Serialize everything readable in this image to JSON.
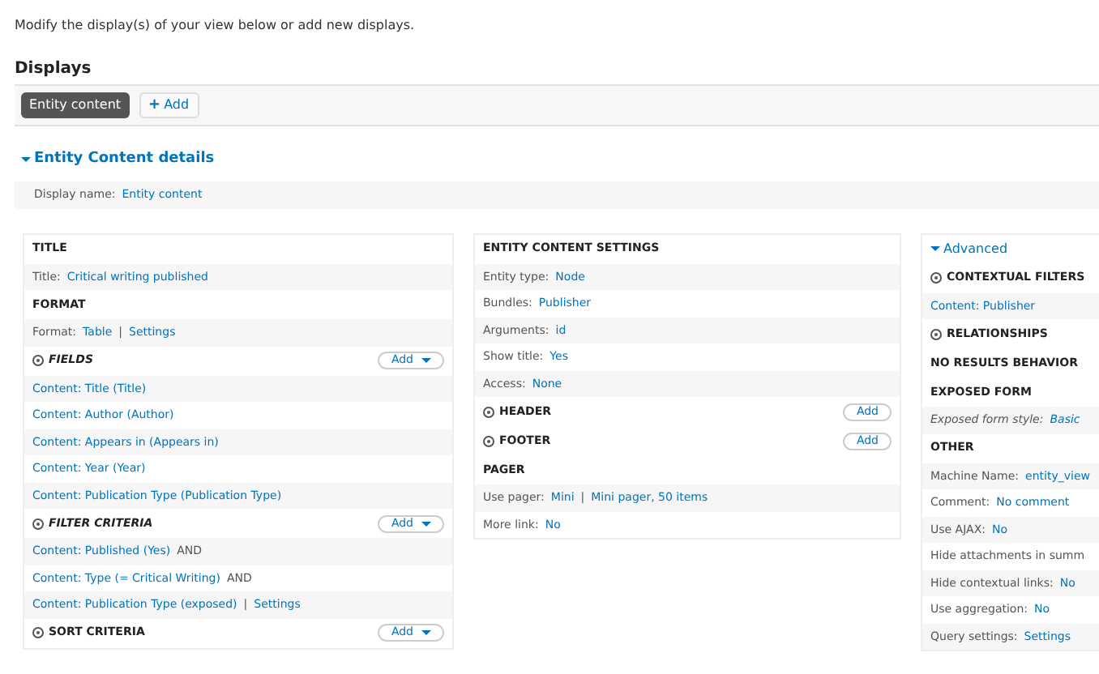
{
  "intro": "Modify the display(s) of your view below or add new displays.",
  "heading": "Displays",
  "tabs": [
    {
      "label": "Entity content",
      "selected": true,
      "kind": "tab"
    },
    {
      "label": "Add",
      "icon": "+",
      "selected": false,
      "kind": "add"
    }
  ],
  "details": {
    "title": "Entity Content details",
    "expanded": true,
    "display_name_label": "Display name:",
    "display_name_value": "Entity content"
  },
  "columns": [
    {
      "sections": [
        {
          "title": "TITLE",
          "icon": false,
          "italic": false,
          "rows": [
            {
              "label": "Title:",
              "value": "Critical writing published"
            }
          ]
        },
        {
          "title": "FORMAT",
          "icon": false,
          "italic": false,
          "rows": [
            {
              "label": "Format:",
              "value": "Table",
              "separator": "|",
              "extra": "Settings"
            }
          ]
        },
        {
          "title": "FIELDS",
          "icon": true,
          "italic": true,
          "add": {
            "label": "Add",
            "dropdown": true
          },
          "rows": [
            {
              "value": "Content: Title (Title)"
            },
            {
              "value": "Content: Author (Author)"
            },
            {
              "value": "Content: Appears in (Appears in)"
            },
            {
              "value": "Content: Year (Year)"
            },
            {
              "value": "Content: Publication Type (Publication Type)"
            }
          ]
        },
        {
          "title": "FILTER CRITERIA",
          "icon": true,
          "italic": true,
          "add": {
            "label": "Add",
            "dropdown": true
          },
          "rows": [
            {
              "value": "Content: Published (Yes)",
              "suffix": "AND"
            },
            {
              "value": "Content: Type (= Critical Writing)",
              "suffix": "AND"
            },
            {
              "value": "Content: Publication Type (exposed)",
              "separator": "|",
              "extra": "Settings"
            }
          ]
        },
        {
          "title": "SORT CRITERIA",
          "icon": true,
          "italic": false,
          "add": {
            "label": "Add",
            "dropdown": true
          }
        }
      ]
    },
    {
      "sections": [
        {
          "title": "ENTITY CONTENT SETTINGS",
          "icon": false,
          "italic": false,
          "rows": [
            {
              "label": "Entity type:",
              "value": "Node"
            },
            {
              "label": "Bundles:",
              "value": "Publisher"
            },
            {
              "label": "Arguments:",
              "value": "id"
            },
            {
              "label": "Show title:",
              "value": "Yes"
            },
            {
              "label": "Access:",
              "value": "None"
            }
          ]
        },
        {
          "title": "HEADER",
          "icon": true,
          "italic": false,
          "add": {
            "label": "Add",
            "dropdown": false
          }
        },
        {
          "title": "FOOTER",
          "icon": true,
          "italic": false,
          "add": {
            "label": "Add",
            "dropdown": false
          }
        },
        {
          "title": "PAGER",
          "icon": false,
          "italic": false,
          "rows": [
            {
              "label": "Use pager:",
              "value": "Mini",
              "separator": "|",
              "extra": "Mini pager, 50 items"
            },
            {
              "label": "More link:",
              "value": "No"
            }
          ]
        }
      ]
    },
    {
      "advanced": {
        "label": "Advanced",
        "expanded": true
      },
      "sections": [
        {
          "title": "CONTEXTUAL FILTERS",
          "icon": true,
          "italic": false,
          "rows": [
            {
              "value": "Content: Publisher"
            }
          ]
        },
        {
          "title": "RELATIONSHIPS",
          "icon": true,
          "italic": false
        },
        {
          "title": "NO RESULTS BEHAVIOR",
          "icon": false,
          "italic": false
        },
        {
          "title": "EXPOSED FORM",
          "icon": false,
          "italic": false,
          "rows": [
            {
              "label": "Exposed form style:",
              "value": "Basic",
              "italic": true
            }
          ]
        },
        {
          "title": "OTHER",
          "icon": false,
          "italic": false,
          "rows": [
            {
              "label": "Machine Name:",
              "value": "entity_view"
            },
            {
              "label": "Comment:",
              "value": "No comment"
            },
            {
              "label": "Use AJAX:",
              "value": "No"
            },
            {
              "label": "Hide attachments in summ"
            },
            {
              "label": "Hide contextual links:",
              "value": "No"
            },
            {
              "label": "Use aggregation:",
              "value": "No"
            },
            {
              "label": "Query settings:",
              "value": "Settings"
            }
          ]
        }
      ]
    }
  ]
}
